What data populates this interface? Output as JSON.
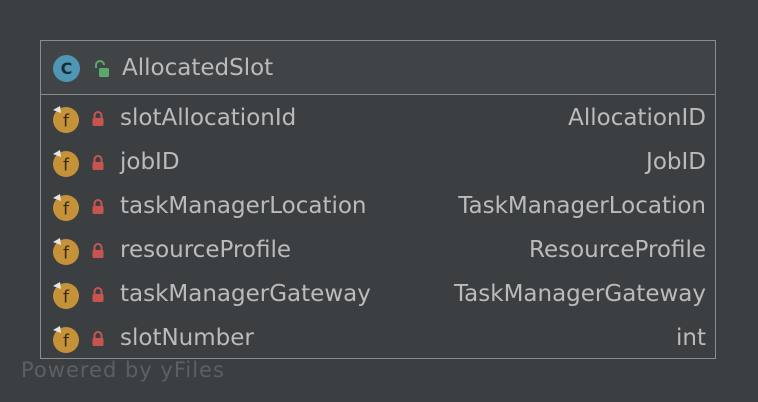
{
  "class": {
    "kind_letter": "C",
    "name": "AllocatedSlot",
    "icon": "class-icon",
    "visibility_icon": "unlocked-icon"
  },
  "fields": [
    {
      "letter": "f",
      "name": "slotAllocationId",
      "type": "AllocationID",
      "icon": "field-icon",
      "visibility_icon": "lock-icon"
    },
    {
      "letter": "f",
      "name": "jobID",
      "type": "JobID",
      "icon": "field-icon",
      "visibility_icon": "lock-icon"
    },
    {
      "letter": "f",
      "name": "taskManagerLocation",
      "type": "TaskManagerLocation",
      "icon": "field-icon",
      "visibility_icon": "lock-icon"
    },
    {
      "letter": "f",
      "name": "resourceProfile",
      "type": "ResourceProfile",
      "icon": "field-icon",
      "visibility_icon": "lock-icon"
    },
    {
      "letter": "f",
      "name": "taskManagerGateway",
      "type": "TaskManagerGateway",
      "icon": "field-icon",
      "visibility_icon": "lock-icon"
    },
    {
      "letter": "f",
      "name": "slotNumber",
      "type": "int",
      "icon": "field-icon",
      "visibility_icon": "lock-icon"
    }
  ],
  "watermark": "Powered by yFiles",
  "colors": {
    "background": "#3c3f41",
    "border": "#8a8d8f",
    "text": "#bbbbbb",
    "class_icon": "#4f95b4",
    "field_icon": "#c5923a",
    "lock": "#c75450",
    "unlock": "#59a869"
  }
}
